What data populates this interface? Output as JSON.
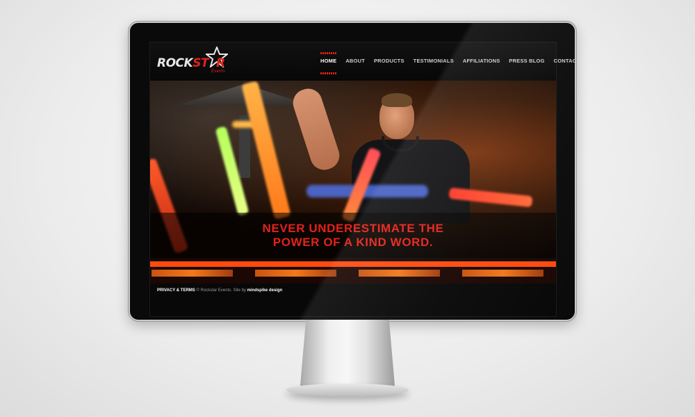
{
  "brand": {
    "logo_rock": "ROCK",
    "logo_star": "ST",
    "logo_r": "R",
    "logo_sub": "Events",
    "accent": "#e3221b"
  },
  "nav": {
    "items": [
      "HOME",
      "ABOUT",
      "PRODUCTS",
      "TESTIMONIALS",
      "AFFILIATIONS",
      "PRESS BLOG",
      "CONTACT"
    ],
    "active": "HOME"
  },
  "hero": {
    "caption_line1": "NEVER UNDERESTIMATE THE",
    "caption_line2": "POWER OF A KIND WORD."
  },
  "footer": {
    "privacy": "PRIVACY & TERMS",
    "copyright": "© Rockstar Events. Site by",
    "designer": "mindspike design"
  }
}
